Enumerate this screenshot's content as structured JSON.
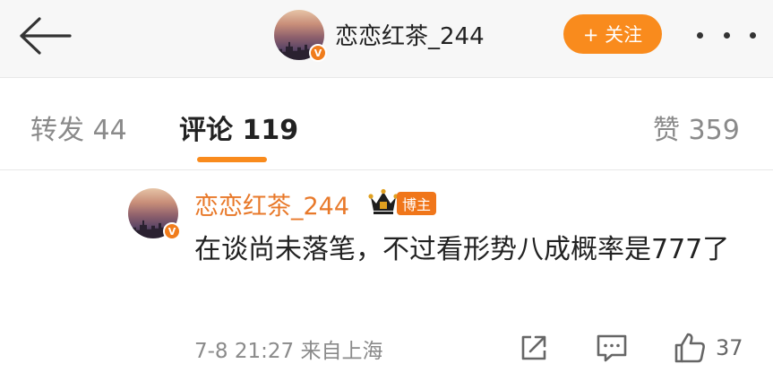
{
  "header": {
    "username": "恋恋红茶_244",
    "verified_badge": "V",
    "follow_label": "+ 关注",
    "back_icon": "arrow-left-icon",
    "more_icon": "more-dots-icon"
  },
  "tabs": [
    {
      "label": "转发 44",
      "active": false
    },
    {
      "label": "评论 119",
      "active": true
    },
    {
      "label": "赞 359",
      "active": false
    }
  ],
  "comment": {
    "username": "恋恋红茶_244",
    "badge": "博主",
    "text": "在谈尚未落笔，不过看形势八成概率是777了",
    "time_source": "7-8 21:27 来自上海",
    "like_count": "37",
    "icons": [
      "share-icon",
      "reply-icon",
      "like-icon",
      "crown-icon"
    ]
  },
  "colors": {
    "accent": "#f98b1d",
    "username": "#e8792a",
    "badge_bg": "#f0761a",
    "header_bg": "#f7f7f7",
    "muted": "#8a8a8a"
  }
}
